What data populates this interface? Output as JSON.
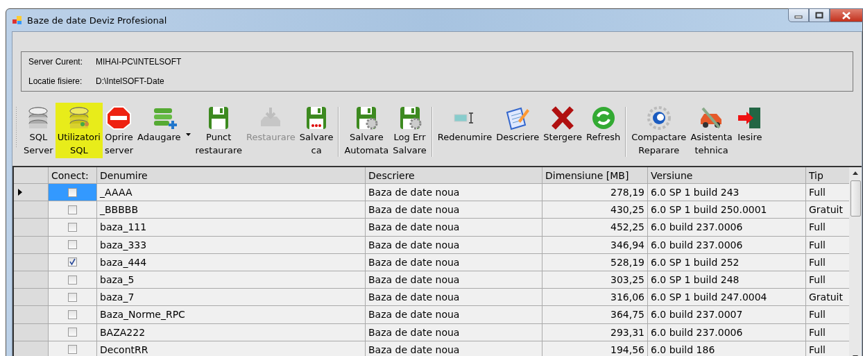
{
  "window": {
    "title": "Baze de date Deviz Profesional"
  },
  "info": [
    {
      "label": "Server Curent:",
      "value": "MIHAI-PC\\INTELSOFT"
    },
    {
      "label": "Locatie fisiere:",
      "value": "D:\\IntelSOFT-Date"
    }
  ],
  "toolbar": {
    "groups": [
      [
        {
          "lines": [
            "SQL",
            "Server"
          ],
          "highlighted": false,
          "disabled": false,
          "dropdown": false
        },
        {
          "lines": [
            "Utilizatori",
            "SQL"
          ],
          "highlighted": true,
          "disabled": false,
          "dropdown": false
        },
        {
          "lines": [
            "Oprire",
            "server"
          ],
          "highlighted": false,
          "disabled": false,
          "dropdown": false
        },
        {
          "lines": [
            "Adaugare"
          ],
          "highlighted": false,
          "disabled": false,
          "dropdown": true
        },
        {
          "lines": [
            "Punct",
            "restaurare"
          ],
          "highlighted": false,
          "disabled": false,
          "dropdown": false
        },
        {
          "lines": [
            "Restaurare"
          ],
          "highlighted": false,
          "disabled": true,
          "dropdown": false
        },
        {
          "lines": [
            "Salvare",
            "ca"
          ],
          "highlighted": false,
          "disabled": false,
          "dropdown": false
        }
      ],
      [
        {
          "lines": [
            "Salvare",
            "Automata"
          ],
          "highlighted": false,
          "disabled": false,
          "dropdown": false
        },
        {
          "lines": [
            "Log Err",
            "Salvare"
          ],
          "highlighted": false,
          "disabled": false,
          "dropdown": false
        }
      ],
      [
        {
          "lines": [
            "Redenumire"
          ],
          "highlighted": false,
          "disabled": false,
          "dropdown": false
        },
        {
          "lines": [
            "Descriere"
          ],
          "highlighted": false,
          "disabled": false,
          "dropdown": false
        },
        {
          "lines": [
            "Stergere"
          ],
          "highlighted": false,
          "disabled": false,
          "dropdown": false
        },
        {
          "lines": [
            "Refresh"
          ],
          "highlighted": false,
          "disabled": false,
          "dropdown": false
        }
      ],
      [
        {
          "lines": [
            "Compactare",
            "Reparare"
          ],
          "highlighted": false,
          "disabled": false,
          "dropdown": false
        },
        {
          "lines": [
            "Asistenta",
            "tehnica"
          ],
          "highlighted": false,
          "disabled": false,
          "dropdown": false
        },
        {
          "lines": [
            "Iesire"
          ],
          "highlighted": false,
          "disabled": false,
          "dropdown": false
        }
      ]
    ]
  },
  "table": {
    "columns": [
      "Conect:",
      "Denumire",
      "Descriere",
      "Dimensiune [MB]",
      "Versiune",
      "Tip"
    ],
    "rows": [
      {
        "selected": true,
        "checked": false,
        "name": "_AAAA",
        "description": "Baza de date noua",
        "size": "278,19",
        "version": "6.0 SP 1 build 243",
        "type": "Full"
      },
      {
        "selected": false,
        "checked": false,
        "name": "_BBBBB",
        "description": "Baza de date noua",
        "size": "430,25",
        "version": "6.0 SP 1 build 250.0001",
        "type": "Gratuit"
      },
      {
        "selected": false,
        "checked": false,
        "name": "baza_111",
        "description": "Baza de date noua",
        "size": "452,25",
        "version": "6.0 build 237.0006",
        "type": "Full"
      },
      {
        "selected": false,
        "checked": false,
        "name": "baza_333",
        "description": "Baza de date noua",
        "size": "346,94",
        "version": "6.0 build 237.0006",
        "type": "Full"
      },
      {
        "selected": false,
        "checked": true,
        "name": "baza_444",
        "description": "Baza de date noua",
        "size": "528,19",
        "version": "6.0 SP 1 build 252",
        "type": "Full"
      },
      {
        "selected": false,
        "checked": false,
        "name": "baza_5",
        "description": "Baza de date noua",
        "size": "303,25",
        "version": "6.0 SP 1 build 248",
        "type": "Full"
      },
      {
        "selected": false,
        "checked": false,
        "name": "baza_7",
        "description": "Baza de date noua",
        "size": "316,06",
        "version": "6.0 SP 1 build 247.0004",
        "type": "Gratuit"
      },
      {
        "selected": false,
        "checked": false,
        "name": "Baza_Norme_RPC",
        "description": "Baza de date noua",
        "size": "364,75",
        "version": "6.0 build 237.0007",
        "type": "Full"
      },
      {
        "selected": false,
        "checked": false,
        "name": "BAZA222",
        "description": "Baza de date noua",
        "size": "293,31",
        "version": "6.0 build 237.0006",
        "type": "Full"
      },
      {
        "selected": false,
        "checked": false,
        "name": "DecontRR",
        "description": "Baza de date noua",
        "size": "194,56",
        "version": "6.0 build 186",
        "type": "Full"
      }
    ]
  }
}
